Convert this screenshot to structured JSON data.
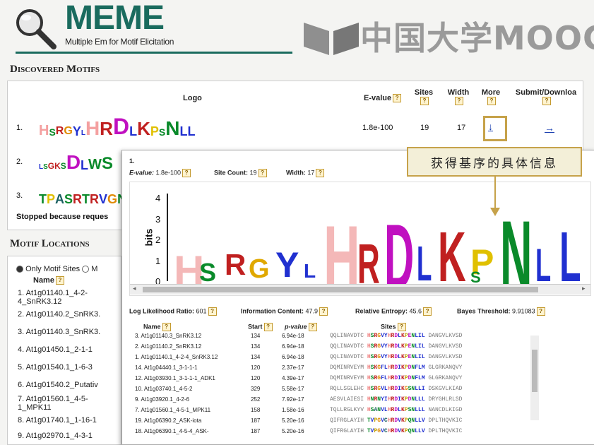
{
  "header": {
    "brand": "MEME",
    "subtitle": "Multiple Em for Motif Elicitation",
    "watermark": "中国大学MOOC",
    "brand_color": "#1a6b5e"
  },
  "discovered": {
    "title": "Discovered Motifs",
    "columns": {
      "logo": "Logo",
      "evalue": "E-value",
      "sites": "Sites",
      "width": "Width",
      "more": "More",
      "submit": "Submit/Downloa"
    },
    "rows": [
      {
        "num": "1.",
        "evalue": "1.8e-100",
        "sites": "19",
        "width": "17",
        "logo": "HSRGYLHRDLKPSNLL"
      },
      {
        "num": "2.",
        "logo": "RLSGKSDLWS"
      },
      {
        "num": "3.",
        "logo": "TPASRTRVGN"
      }
    ],
    "more_link": "↓",
    "submit_link": "→",
    "stopped": "Stopped because reques"
  },
  "locations": {
    "title": "Motif Locations",
    "radio_only": "Only Motif Sites",
    "radio_other": "M",
    "name_header": "Name",
    "items": [
      "1. At1g01140.1_4-2-4_SnRK3.12",
      "2. At1g01140.2_SnRK3.",
      "3. At1g01140.3_SnRK3.",
      "4. At1g01450.1_2-1-1",
      "5. At1g01540.1_1-6-3",
      "6. At1g01540.2_Putativ",
      "7. At1g01560.1_4-5-1_MPK11",
      "8. At1g01740.1_1-16-1",
      "9. At1g02970.1_4-3-1"
    ]
  },
  "popup": {
    "num": "1.",
    "evalue_label": "E-value:",
    "evalue": "1.8e-100",
    "site_count_label": "Site Count:",
    "site_count": "19",
    "width_label": "Width:",
    "width": "17",
    "ylabel": "bits",
    "yticks": [
      "4",
      "3",
      "2",
      "1",
      "0"
    ],
    "llr_label": "Log Likelihood Ratio:",
    "llr": "601",
    "ic_label": "Information Content:",
    "ic": "47.9",
    "re_label": "Relative Entropy:",
    "re": "45.6",
    "bt_label": "Bayes Threshold:",
    "bt": "9.91083",
    "table_headers": {
      "name": "Name",
      "start": "Start",
      "pvalue": "p-value",
      "sites": "Sites"
    },
    "rows": [
      {
        "name": "3. At1g01140.3_SnRK3.12",
        "start": "134",
        "p": "6.94e-18",
        "left": "QQLINAVDTC",
        "site": "HSRGVYHRDLKPENLIL",
        "right": "DANGVLKVSD"
      },
      {
        "name": "2. At1g01140.2_SnRK3.12",
        "start": "134",
        "p": "6.94e-18",
        "left": "QQLINAVDTC",
        "site": "HSRGVYHRDLKPENLIL",
        "right": "DANGVLKVSD"
      },
      {
        "name": "1. At1g01140.1_4-2-4_SnRK3.12",
        "start": "134",
        "p": "6.94e-18",
        "left": "QQLINAVDTC",
        "site": "HSRGVYHRDLKPENLIL",
        "right": "DANGVLKVSD"
      },
      {
        "name": "14. At1g04440.1_3-1-1-1",
        "start": "120",
        "p": "2.37e-17",
        "left": "DQMINRVEYM",
        "site": "HSKGFLHRDIKPDNFLM",
        "right": "GLGRKANQVY"
      },
      {
        "name": "12. At1g03930.1_3-1-1-1_ADK1",
        "start": "120",
        "p": "4.39e-17",
        "left": "DQMINRVEYM",
        "site": "HSRGFLHRDIKPDNFLM",
        "right": "GLGRKANQVY"
      },
      {
        "name": "10. At1g03740.1_4-5-2",
        "start": "329",
        "p": "5.58e-17",
        "left": "RQLLSGLEHC",
        "site": "HSRGVLHRDIKGSNLLI",
        "right": "DSKGVLKIAD"
      },
      {
        "name": "9. At1g03920.1_4-2-6",
        "start": "252",
        "p": "7.92e-17",
        "left": "AESVLAIESI",
        "site": "HNRNYIHRDIKPDNLLL",
        "right": "DRYGHLRLSD"
      },
      {
        "name": "7. At1g01560.1_4-5-1_MPK11",
        "start": "158",
        "p": "1.58e-16",
        "left": "TQLLRGLKYV",
        "site": "HSANVLHRDLKPSNLLL",
        "right": "NANCDLKIGD"
      },
      {
        "name": "19. At1g06390.2_ASK-iota",
        "start": "187",
        "p": "5.20e-16",
        "left": "QIFRGLAYIH",
        "site": "TVPGVCHRDVKPQNLLV",
        "right": "DPLTHQVKIC"
      },
      {
        "name": "18. At1g06390.1_4-5-4_ASK-",
        "start": "187",
        "p": "5.20e-16",
        "left": "QIFRGLAYIH",
        "site": "TVPGVCHRDVKPQNLLV",
        "right": "DPLTHQVKIC"
      }
    ]
  },
  "callout": "获得基序的具体信息"
}
